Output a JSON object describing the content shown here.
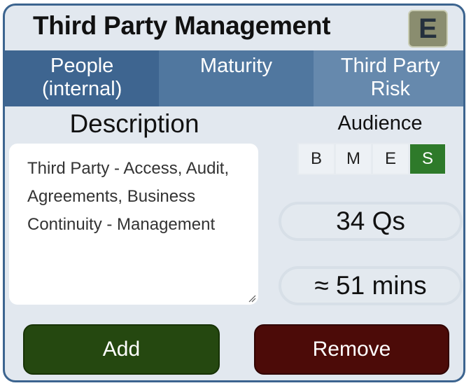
{
  "card": {
    "title": "Third Party Management",
    "level_badge": "E"
  },
  "tabs": [
    {
      "label": "People\n(internal)"
    },
    {
      "label": "Maturity"
    },
    {
      "label": "Third Party\nRisk"
    }
  ],
  "description": {
    "label": "Description",
    "text": "Third Party - Access, Audit, Agreements, Business Continuity - Management"
  },
  "audience": {
    "label": "Audience",
    "options": [
      "B",
      "M",
      "E",
      "S"
    ],
    "selected": "S"
  },
  "stats": {
    "questions": "34 Qs",
    "duration": "≈ 51 mins"
  },
  "actions": {
    "add_label": "Add",
    "remove_label": "Remove"
  },
  "colors": {
    "border": "#3c648f",
    "add": "#254810",
    "remove": "#4c0b08",
    "audience_selected": "#2e7a2a"
  }
}
